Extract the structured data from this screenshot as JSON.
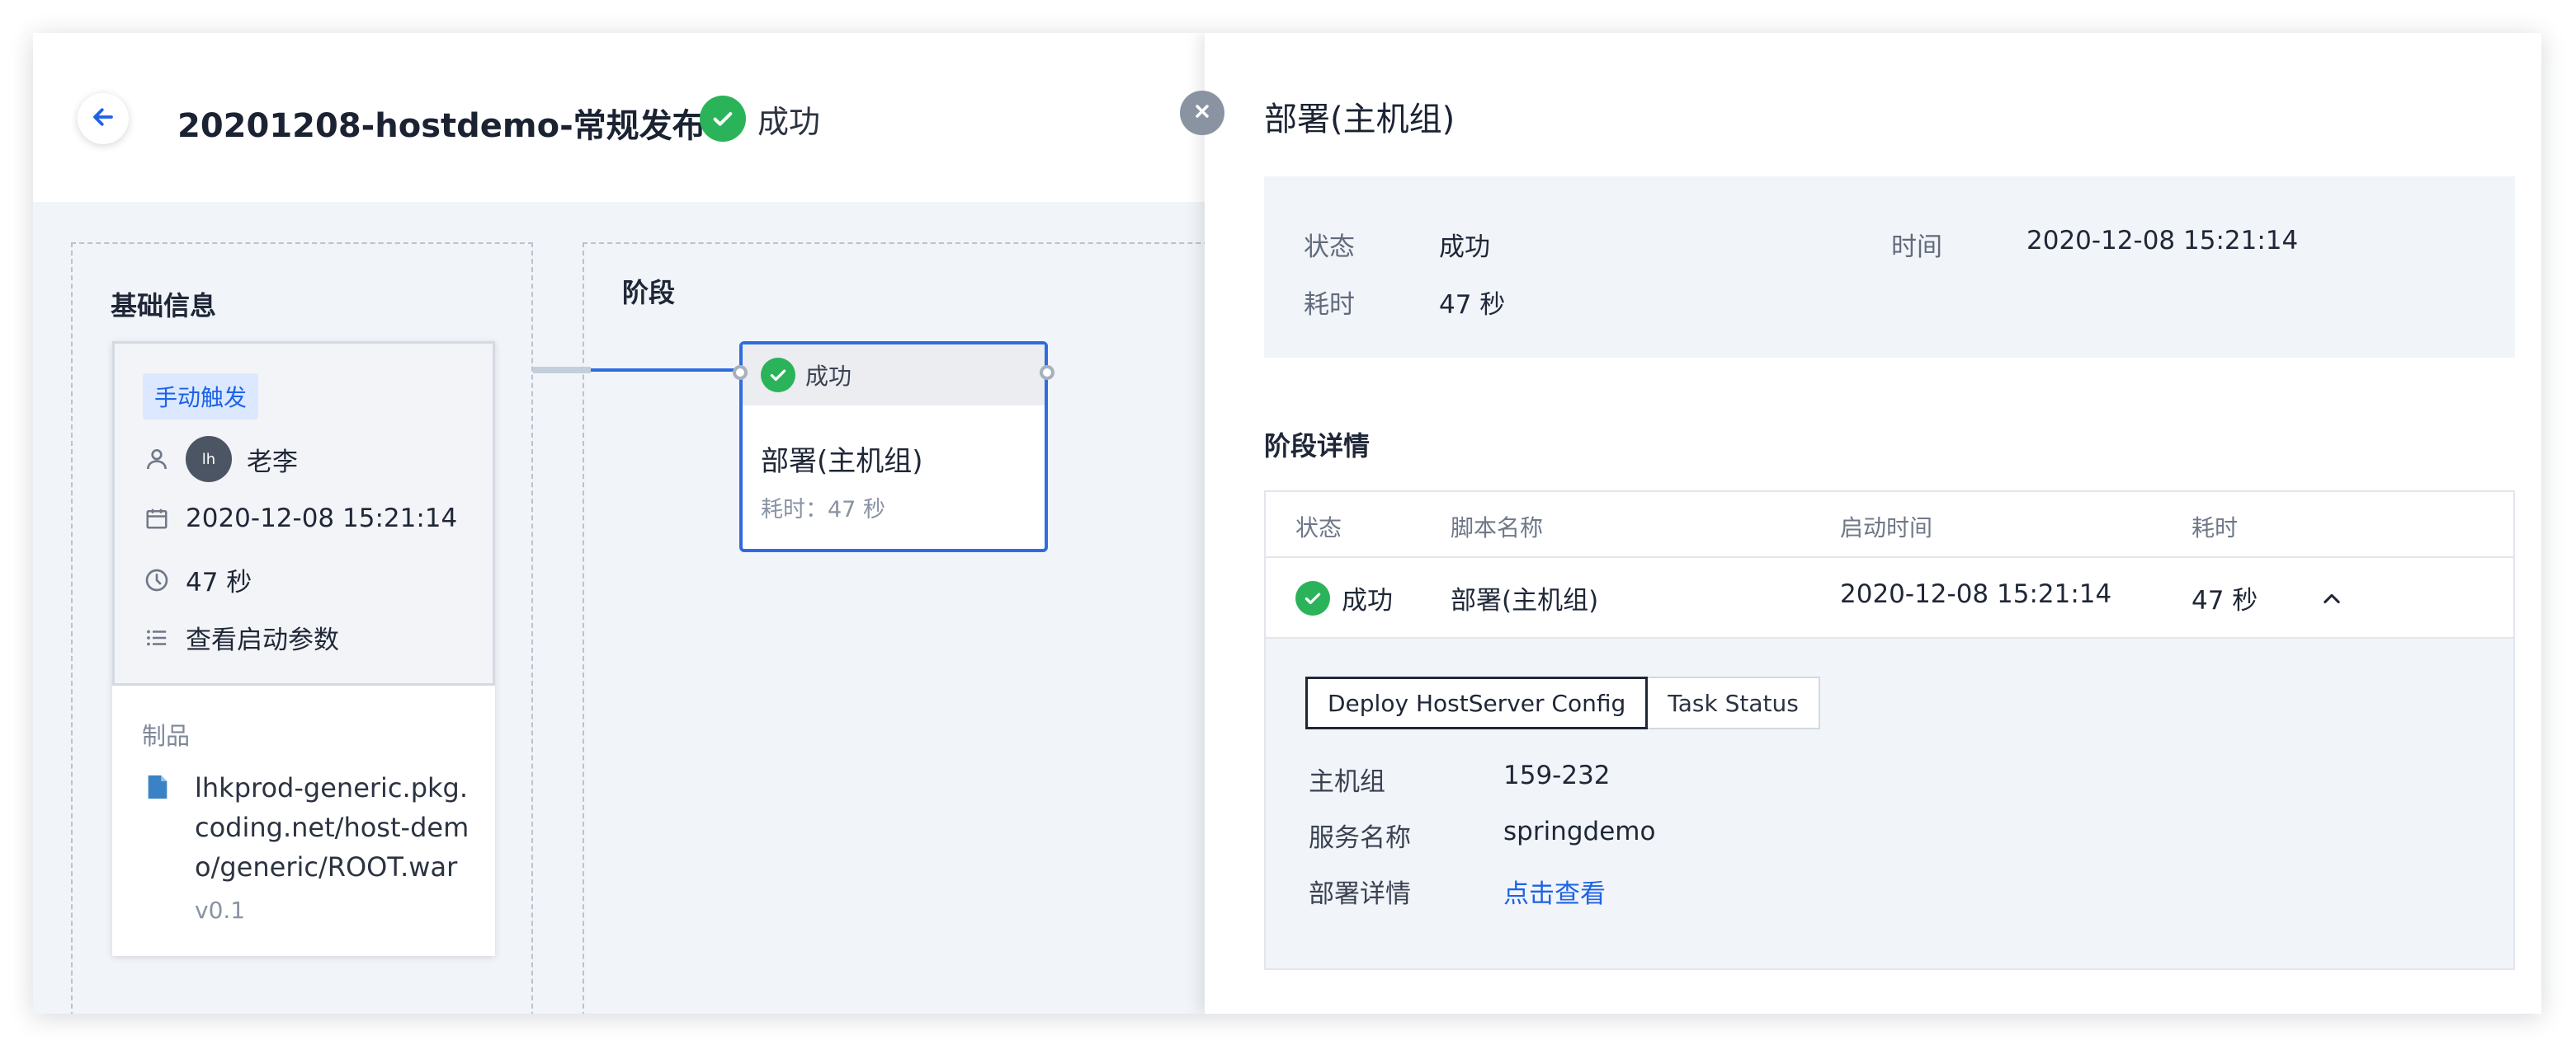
{
  "header": {
    "title": "20201208-hostdemo-常规发布",
    "status": "成功"
  },
  "basic_info": {
    "section_title": "基础信息",
    "trigger_tag": "手动触发",
    "user_avatar": "lh",
    "user_name": "老李",
    "start_time": "2020-12-08 15:21:14",
    "duration": "47 秒",
    "view_params": "查看启动参数",
    "product_label": "制品",
    "product_path": "lhkprod-generic.pkg.coding.net/host-demo/generic/ROOT.war",
    "product_version": "v0.1"
  },
  "stages": {
    "section_title": "阶段",
    "node": {
      "status": "成功",
      "name": "部署(主机组)",
      "time": "耗时：47 秒"
    }
  },
  "panel": {
    "title": "部署(主机组)",
    "summary": {
      "status_label": "状态",
      "status_value": "成功",
      "time_label": "时间",
      "time_value": "2020-12-08 15:21:14",
      "duration_label": "耗时",
      "duration_value": "47 秒"
    },
    "detail_title": "阶段详情",
    "table": {
      "columns": [
        "状态",
        "脚本名称",
        "启动时间",
        "耗时"
      ],
      "row": {
        "status": "成功",
        "script": "部署(主机组)",
        "start_time": "2020-12-08 15:21:14",
        "duration": "47 秒"
      },
      "tabs": [
        "Deploy HostServer Config",
        "Task Status"
      ],
      "details": {
        "host_group_label": "主机组",
        "host_group_value": "159-232",
        "service_label": "服务名称",
        "service_value": "springdemo",
        "deploy_label": "部署详情",
        "deploy_link": "点击查看"
      }
    }
  },
  "colors": {
    "success": "#2bb35a",
    "accent": "#2f6ce0",
    "link": "#1e63e6",
    "tag_bg": "#dbe8ff"
  }
}
